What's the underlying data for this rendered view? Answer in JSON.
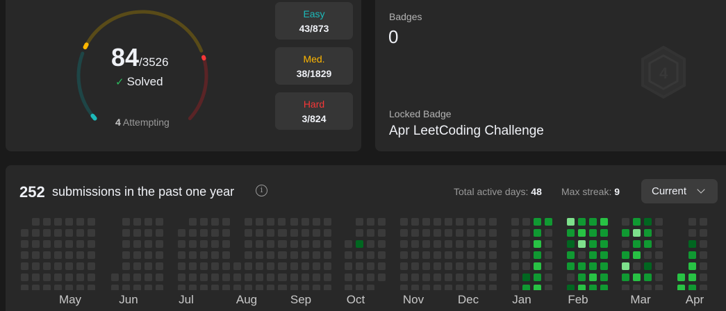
{
  "progress": {
    "solved": "84",
    "total": "/3526",
    "solved_label": "Solved",
    "attempting_count": "4",
    "attempting_label": "Attempting",
    "easy": {
      "label": "Easy",
      "value": "43/873",
      "color": "#1cbaba"
    },
    "medium": {
      "label": "Med.",
      "value": "38/1829",
      "color": "#ffb700"
    },
    "hard": {
      "label": "Hard",
      "value": "3/824",
      "color": "#f63737"
    }
  },
  "badges": {
    "label": "Badges",
    "count": "0",
    "locked_label": "Locked Badge",
    "locked_name": "Apr LeetCoding Challenge",
    "icon": "locked-badge-hexagon-icon"
  },
  "heatmap": {
    "count": "252",
    "text": "submissions in the past one year",
    "info_icon": "info-icon",
    "active_days_label": "Total active days:",
    "active_days": "48",
    "max_streak_label": "Max streak:",
    "max_streak": "9",
    "period": "Current",
    "months": [
      "May",
      "Jun",
      "Jul",
      "Aug",
      "Sep",
      "Oct",
      "Nov",
      "Dec",
      "Jan",
      "Feb",
      "Mar",
      "Apr"
    ],
    "colors": {
      "empty": "#3a3a3a",
      "l1": "#016620",
      "l2": "#109932",
      "l3": "#28c244",
      "l4": "#7ee08c"
    }
  }
}
